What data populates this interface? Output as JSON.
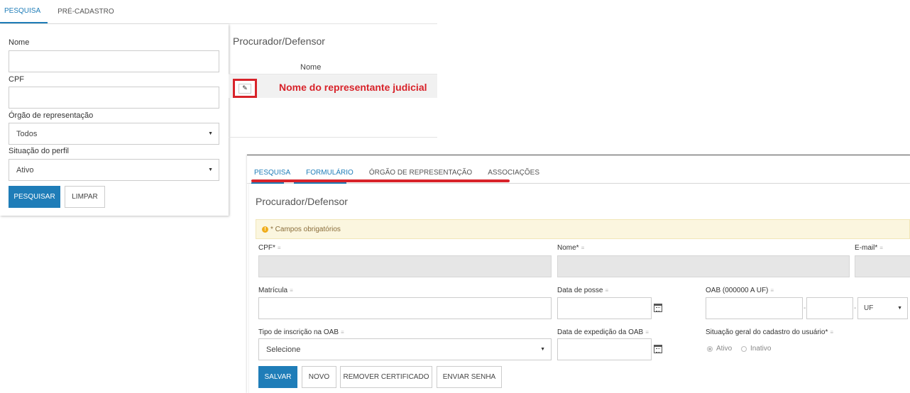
{
  "search_tabs": [
    {
      "label": "PESQUISA",
      "active": true
    },
    {
      "label": "PRÉ-CADASTRO",
      "active": false
    }
  ],
  "search_panel": {
    "nome_label": "Nome",
    "nome_value": "",
    "cpf_label": "CPF",
    "cpf_value": "",
    "orgao_label": "Órgão de representação",
    "orgao_selected": "Todos",
    "situacao_label": "Situação do perfil",
    "situacao_selected": "Ativo",
    "search_button": "PESQUISAR",
    "clear_button": "LIMPAR"
  },
  "result_panel": {
    "title": "Procurador/Defensor",
    "column_header": "Nome",
    "row_name": "Nome do representante judicial"
  },
  "form_tabs": [
    {
      "label": "PESQUISA",
      "active": true
    },
    {
      "label": "FORMULÁRIO",
      "active": true
    },
    {
      "label": "ÓRGÃO DE REPRESENTAÇÃO",
      "active": false
    },
    {
      "label": "ASSOCIAÇÕES",
      "active": false
    }
  ],
  "form": {
    "title": "Procurador/Defensor",
    "notice": "* Campos obrigatórios",
    "cpf_label": "CPF*",
    "nome_label": "Nome*",
    "email_label": "E-mail*",
    "matricula_label": "Matrícula",
    "data_posse_label": "Data de posse",
    "oab_label": "OAB (000000 A UF)",
    "oab_dash": "-",
    "oab_uf_selected": "UF",
    "tipo_inscricao_label": "Tipo de inscrição na OAB",
    "tipo_inscricao_selected": "Selecione",
    "data_expedicao_label": "Data de expedição da OAB",
    "situacao_label": "Situação geral do cadastro do usuário*",
    "radio_ativo": "Ativo",
    "radio_inativo": "Inativo",
    "buttons": {
      "save": "SALVAR",
      "new": "NOVO",
      "remove_cert": "REMOVER CERTIFICADO",
      "send_password": "ENVIAR SENHA"
    }
  },
  "colors": {
    "primary": "#1f7db8",
    "highlight_red": "#d8232a",
    "notice_bg": "#fbf6df"
  }
}
